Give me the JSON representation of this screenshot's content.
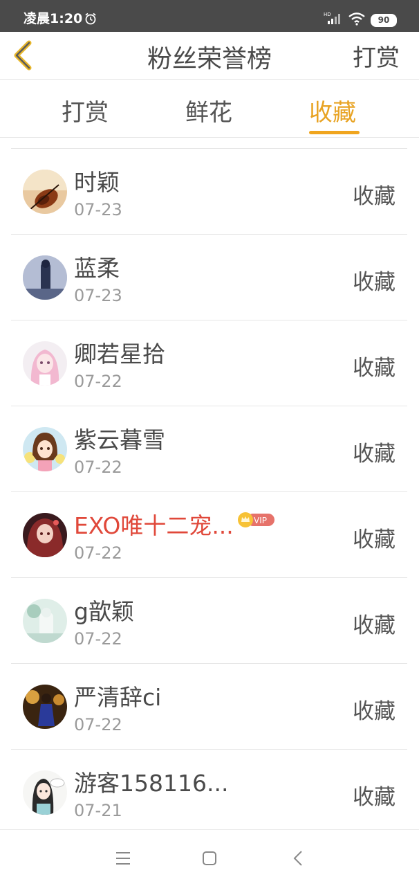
{
  "status_bar": {
    "time": "凌晨1:20",
    "battery": "90",
    "network": "HD"
  },
  "header": {
    "title": "粉丝荣誉榜",
    "action": "打赏"
  },
  "tabs": [
    {
      "label": "打赏",
      "active": false
    },
    {
      "label": "鲜花",
      "active": false
    },
    {
      "label": "收藏",
      "active": true
    }
  ],
  "colors": {
    "accent": "#f0a51e",
    "vip_name": "#e0483a",
    "status_bar": "#4a4a4a"
  },
  "list": [
    {
      "name": "时颖",
      "date": "07-23",
      "action": "收藏",
      "vip": false
    },
    {
      "name": "蓝柔",
      "date": "07-23",
      "action": "收藏",
      "vip": false
    },
    {
      "name": "卿若星拾",
      "date": "07-22",
      "action": "收藏",
      "vip": false
    },
    {
      "name": "紫云暮雪",
      "date": "07-22",
      "action": "收藏",
      "vip": false
    },
    {
      "name": "EXO唯十二宠...",
      "date": "07-22",
      "action": "收藏",
      "vip": true,
      "vip_label": "VIP"
    },
    {
      "name": "g歆颖",
      "date": "07-22",
      "action": "收藏",
      "vip": false
    },
    {
      "name": "严清辞ci",
      "date": "07-22",
      "action": "收藏",
      "vip": false
    },
    {
      "name": "游客158116...",
      "date": "07-21",
      "action": "收藏",
      "vip": false
    }
  ],
  "icons": {
    "back": "chevron-left-icon",
    "alarm": "alarm-clock-icon",
    "wifi": "wifi-icon",
    "nav_menu": "menu-icon",
    "nav_home": "home-square-icon",
    "nav_back": "back-triangle-icon"
  }
}
